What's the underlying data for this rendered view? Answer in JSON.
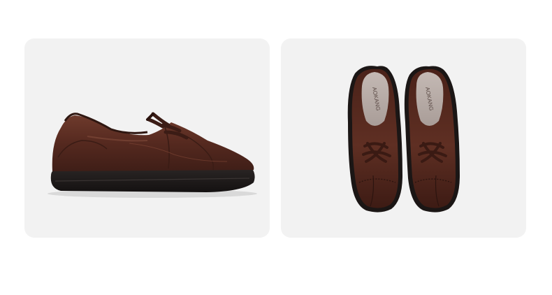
{
  "images": [
    {
      "name": "shoe-side-view",
      "description_label": ""
    },
    {
      "name": "shoes-top-view",
      "insole_brand": "AOKANG"
    }
  ],
  "colors": {
    "page_background": "#ffffff",
    "card_background": "#f2f2f2",
    "leather": "#5a2e22",
    "sole": "#1e1a19",
    "insole": "#b7aba6"
  }
}
